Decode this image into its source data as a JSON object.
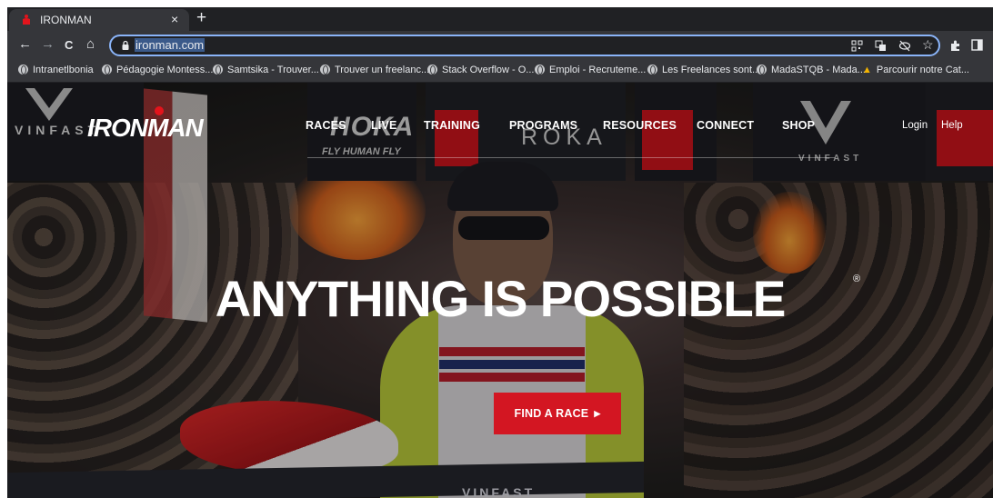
{
  "browser": {
    "tab": {
      "title": "IRONMAN",
      "close": "×"
    },
    "new_tab": "+",
    "nav": {
      "back": "←",
      "forward": "→",
      "reload": "C",
      "home": "⌂"
    },
    "url": "ironman.com",
    "omnibox_icons": [
      "qr-icon",
      "translate-icon",
      "eye-off-icon",
      "star-icon"
    ],
    "toolbar_icons": [
      "extensions-icon",
      "sidepanel-icon"
    ],
    "bookmarks": [
      "Intranetlbonia",
      "Pédagogie Montess...",
      "Samtsika - Trouver...",
      "Trouver un freelanc...",
      "Stack Overflow - O...",
      "Emploi - Recruteme...",
      "Les Freelances sont...",
      "MadaSTQB - Mada...",
      "Parcourir notre Cat..."
    ]
  },
  "site": {
    "logo": "IRONMAN",
    "nav": [
      "RACES",
      "LIVE",
      "TRAINING",
      "PROGRAMS",
      "RESOURCES",
      "CONNECT",
      "SHOP"
    ],
    "login": "Login",
    "help": "Help",
    "sponsors": {
      "left": "VINFAST",
      "hoka": "HOKA",
      "hoka_sub": "FLY HUMAN FLY",
      "roka": "ROKA",
      "right": "VINFAST",
      "bottom": "VINFAST"
    },
    "hero_title": "ANYTHING IS POSSIBLE",
    "hero_mark": "®",
    "cta": "FIND A RACE",
    "cta_arrow": "▶"
  },
  "colors": {
    "accent": "#d31622",
    "browser_bg": "#202124",
    "toolbar": "#35363a",
    "focus_ring": "#8ab4f8"
  }
}
